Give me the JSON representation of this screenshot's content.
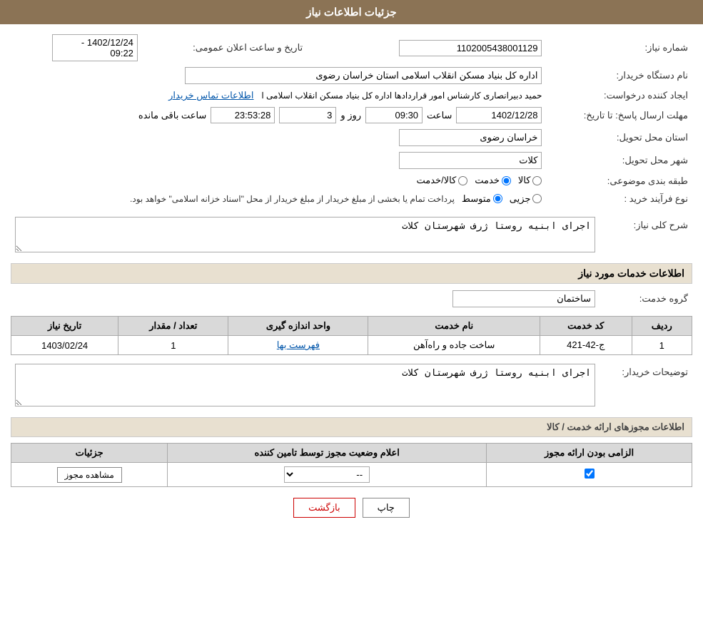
{
  "header": {
    "title": "جزئیات اطلاعات نیاز"
  },
  "fields": {
    "shomara_niaz_label": "شماره نیاز:",
    "shomara_niaz_value": "1102005438001129",
    "nam_dastgah_label": "نام دستگاه خریدار:",
    "nam_dastgah_value": "اداره کل بنیاد مسکن انقلاب اسلامی استان خراسان رضوی",
    "ijad_konande_label": "ایجاد کننده درخواست:",
    "ijad_konande_value": "حمید دبیرانصاری کارشناس امور قراردادها اداره کل بنیاد مسکن انقلاب اسلامی ا",
    "ettelaat_tamas_label": "اطلاعات تماس خریدار",
    "tarikh_saaat_label": "تاریخ و ساعت اعلان عمومی:",
    "tarikh_saaat_value": "1402/12/24 - 09:22",
    "mohlat_ersal_label": "مهلت ارسال پاسخ: تا تاریخ:",
    "tarikh_niaz": "1402/12/28",
    "saat_niaz": "09:30",
    "rooz_niaz": "3",
    "baqi_mande": "23:53:28",
    "ostan_tahvil_label": "استان محل تحویل:",
    "ostan_tahvil_value": "خراسان رضوی",
    "shahr_tahvil_label": "شهر محل تحویل:",
    "shahr_tahvil_value": "کلات",
    "tabaqe_bandi_label": "طبقه بندی موضوعی:",
    "kala_label": "کالا",
    "khadamat_label": "خدمت",
    "kala_khadamat_label": "کالا/خدمت",
    "khadamat_selected": true,
    "nooe_farayand_label": "نوع فرآیند خرید :",
    "jozi_label": "جزیی",
    "motovaset_label": "متوسط",
    "farayand_desc": "پرداخت تمام یا بخشی از مبلغ خریدار از مبلغ خریدار از محل \"اسناد خزانه اسلامی\" خواهد بود.",
    "sharh_kolly_label": "شرح کلی نیاز:",
    "sharh_kolly_value": "اجرای ابنیه روستا ژرف شهرستان کلات",
    "khadamat_section_label": "اطلاعات خدمات مورد نیاز",
    "grooh_khadamat_label": "گروه خدمت:",
    "grooh_khadamat_value": "ساختمان",
    "table": {
      "headers": [
        "ردیف",
        "کد خدمت",
        "نام خدمت",
        "واحد اندازه گیری",
        "تعداد / مقدار",
        "تاریخ نیاز"
      ],
      "rows": [
        {
          "radif": "1",
          "kod_khadamat": "ج-42-421",
          "naam_khadamat": "ساخت جاده و راه‌آهن",
          "vahed": "فهرست بها",
          "tedad": "1",
          "tarikh": "1403/02/24"
        }
      ]
    },
    "tozihat_label": "توضیحات خریدار:",
    "tozihat_value": "اجرای ابنیه روستا ژرف شهرستان کلات",
    "mojowzat_header": "اطلاعات مجوزهای ارائه خدمت / کالا",
    "mojowzat_table": {
      "headers": [
        "الزامی بودن ارائه مجوز",
        "اعلام وضعیت مجوز توسط تامین کننده",
        "جزئیات"
      ],
      "rows": [
        {
          "elzami": true,
          "eelam": "--",
          "joziat": "مشاهده مجوز"
        }
      ]
    },
    "print_label": "چاپ",
    "back_label": "بازگشت",
    "saat_label": "ساعت",
    "rooz_label": "روز و",
    "baqi_label": "ساعت باقی مانده"
  }
}
